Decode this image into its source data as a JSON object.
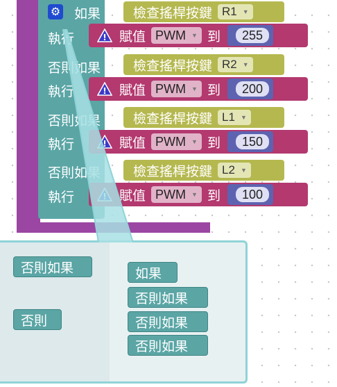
{
  "if_block": {
    "if_label": "如果",
    "do_label": "執行",
    "elseif_label": "否則如果",
    "gear_icon": "gear-icon"
  },
  "rows": [
    {
      "button": "R1",
      "value": "255"
    },
    {
      "button": "R2",
      "value": "200"
    },
    {
      "button": "L1",
      "value": "150"
    },
    {
      "button": "L2",
      "value": "100"
    }
  ],
  "joystick_label": "檢查搖桿按鍵",
  "assign_label": "賦值",
  "pwm_label": "PWM",
  "to_label": "到",
  "popup": {
    "palette": {
      "elseif": "否則如果",
      "else": "否則"
    },
    "stack": {
      "if": "如果",
      "elseif": [
        "否則如果",
        "否則如果",
        "否則如果"
      ]
    }
  },
  "colors": {
    "outer": "#9b46a3",
    "if_block": "#5ba5a5",
    "joystick": "#b5b84f",
    "assign": "#b3396f",
    "number": "#5d63b0",
    "popup_border": "#8fd3d8"
  }
}
